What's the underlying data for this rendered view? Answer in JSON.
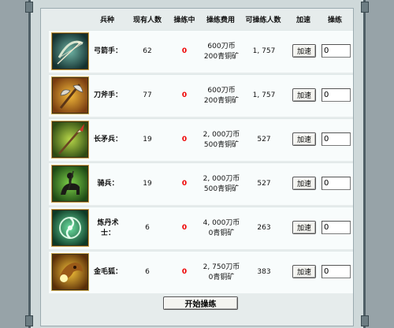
{
  "headers": {
    "type": "兵种",
    "current": "现有人数",
    "training": "操练中",
    "cost": "操练费用",
    "available": "可操练人数",
    "speed": "加速",
    "drill": "操练"
  },
  "units": [
    {
      "name": "弓箭手：",
      "current": "62",
      "training": "0",
      "cost_coin": "600刀币",
      "cost_ore": "200青铜矿",
      "available": "1, 757",
      "speed_label": "加速",
      "qty": "0",
      "icon": "bow-icon"
    },
    {
      "name": "刀斧手：",
      "current": "77",
      "training": "0",
      "cost_coin": "600刀币",
      "cost_ore": "200青铜矿",
      "available": "1, 757",
      "speed_label": "加速",
      "qty": "0",
      "icon": "axe-icon"
    },
    {
      "name": "长矛兵：",
      "current": "19",
      "training": "0",
      "cost_coin": "2, 000刀币",
      "cost_ore": "500青铜矿",
      "available": "527",
      "speed_label": "加速",
      "qty": "0",
      "icon": "spear-icon"
    },
    {
      "name": "骑兵：",
      "current": "19",
      "training": "0",
      "cost_coin": "2, 000刀币",
      "cost_ore": "500青铜矿",
      "available": "527",
      "speed_label": "加速",
      "qty": "0",
      "icon": "cavalry-icon"
    },
    {
      "name": "炼丹术士：",
      "current": "6",
      "training": "0",
      "cost_coin": "4, 000刀币",
      "cost_ore": "0青铜矿",
      "available": "263",
      "speed_label": "加速",
      "qty": "0",
      "icon": "alchemist-icon"
    },
    {
      "name": "金毛狐：",
      "current": "6",
      "training": "0",
      "cost_coin": "2, 750刀币",
      "cost_ore": "0青铜矿",
      "available": "383",
      "speed_label": "加速",
      "qty": "0",
      "icon": "golden-fox-icon"
    }
  ],
  "start_button": "开始操练",
  "colors": {
    "training_zero": "#e00000",
    "panel": "#e6ecec",
    "frame": "#4f5f66"
  }
}
